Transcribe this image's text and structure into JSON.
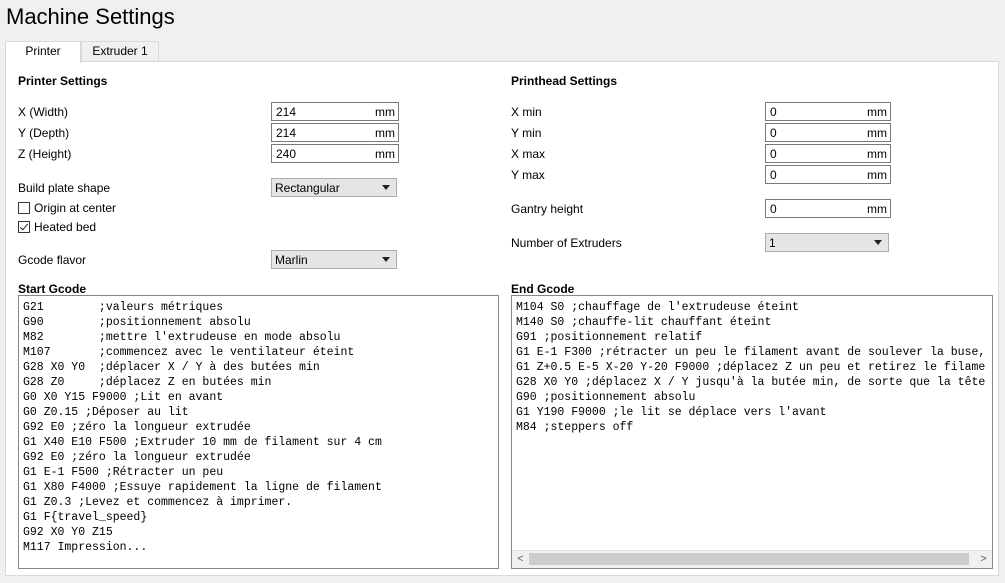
{
  "window": {
    "title": "Machine Settings"
  },
  "tabs": [
    {
      "label": "Printer",
      "active": true
    },
    {
      "label": "Extruder 1",
      "active": false
    }
  ],
  "printer_settings": {
    "heading": "Printer Settings",
    "x_label": "X (Width)",
    "x_value": "214",
    "x_unit": "mm",
    "y_label": "Y (Depth)",
    "y_value": "214",
    "y_unit": "mm",
    "z_label": "Z (Height)",
    "z_value": "240",
    "z_unit": "mm",
    "build_plate_label": "Build plate shape",
    "build_plate_value": "Rectangular",
    "origin_label": "Origin at center",
    "origin_checked": false,
    "heated_label": "Heated bed",
    "heated_checked": true,
    "gcode_flavor_label": "Gcode flavor",
    "gcode_flavor_value": "Marlin"
  },
  "printhead_settings": {
    "heading": "Printhead Settings",
    "xmin_label": "X min",
    "xmin_value": "0",
    "xmin_unit": "mm",
    "ymin_label": "Y min",
    "ymin_value": "0",
    "ymin_unit": "mm",
    "xmax_label": "X max",
    "xmax_value": "0",
    "xmax_unit": "mm",
    "ymax_label": "Y max",
    "ymax_value": "0",
    "ymax_unit": "mm",
    "gantry_label": "Gantry height",
    "gantry_value": "0",
    "gantry_unit": "mm",
    "extruders_label": "Number of Extruders",
    "extruders_value": "1"
  },
  "start_gcode": {
    "heading": "Start Gcode",
    "lines": [
      "G21        ;valeurs métriques",
      "G90        ;positionnement absolu",
      "M82        ;mettre l'extrudeuse en mode absolu",
      "M107       ;commencez avec le ventilateur éteint",
      "G28 X0 Y0  ;déplacer X / Y à des butées min",
      "G28 Z0     ;déplacez Z en butées min",
      "G0 X0 Y15 F9000 ;Lit en avant",
      "G0 Z0.15 ;Déposer au lit",
      "G92 E0 ;zéro la longueur extrudée",
      "G1 X40 E10 F500 ;Extruder 10 mm de filament sur 4 cm",
      "G92 E0 ;zéro la longueur extrudée",
      "G1 E-1 F500 ;Rétracter un peu",
      "G1 X80 F4000 ;Essuye rapidement la ligne de filament",
      "G1 Z0.3 ;Levez et commencez à imprimer.",
      "G1 F{travel_speed}",
      "G92 X0 Y0 Z15",
      "M117 Impression..."
    ]
  },
  "end_gcode": {
    "heading": "End Gcode",
    "lines": [
      "M104 S0 ;chauffage de l'extrudeuse éteint",
      "M140 S0 ;chauffe-lit chauffant éteint",
      "G91 ;positionnement relatif",
      "G1 E-1 F300 ;rétracter un peu le filament avant de soulever la buse,",
      "G1 Z+0.5 E-5 X-20 Y-20 F9000 ;déplacez Z un peu et retirez le filame",
      "G28 X0 Y0 ;déplacez X / Y jusqu'à la butée min, de sorte que la tête",
      "G90 ;positionnement absolu",
      "G1 Y190 F9000 ;le lit se déplace vers l'avant",
      "M84 ;steppers off"
    ]
  },
  "scroll": {
    "left_arrow": "<",
    "right_arrow": ">"
  }
}
